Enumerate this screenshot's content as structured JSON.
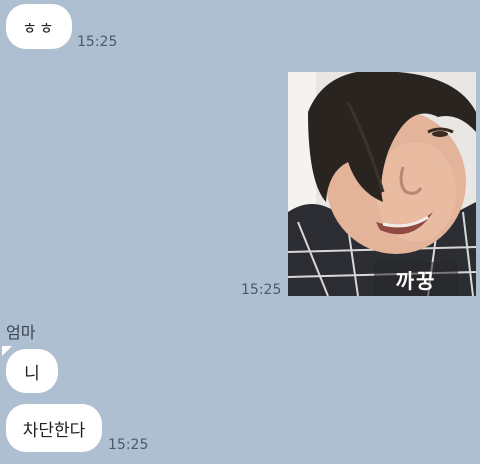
{
  "messages": [
    {
      "text": "ㅎㅎ",
      "time": "15:25"
    },
    {
      "image_caption": "까꿍",
      "time": "15:25"
    },
    {
      "sender": "엄마",
      "texts": [
        "니",
        "차단한다"
      ],
      "time": "15:25"
    }
  ],
  "colors": {
    "background": "#aebfd1",
    "bubble": "#ffffff",
    "timestamp": "#4a5a6c"
  }
}
